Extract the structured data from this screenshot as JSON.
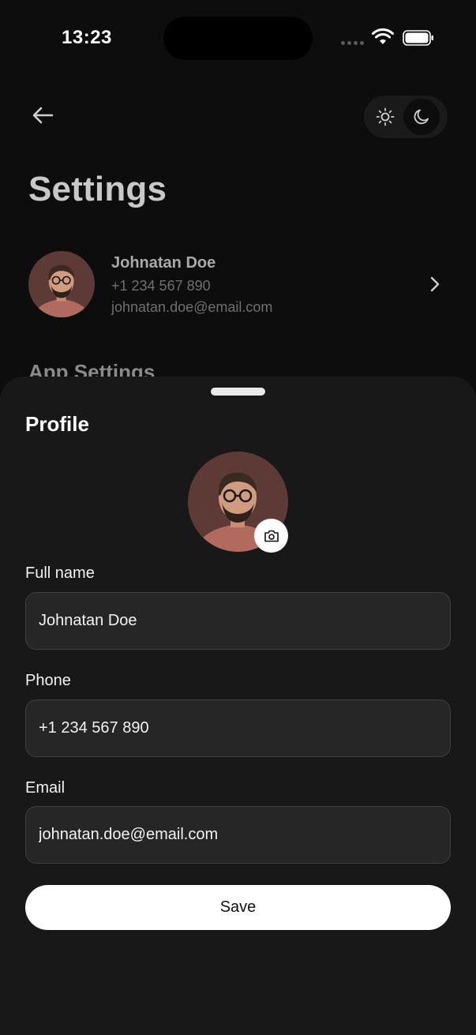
{
  "status_bar": {
    "time": "13:23"
  },
  "header": {
    "back_icon": "arrow-left-icon",
    "theme_options": [
      "sun-icon",
      "moon-icon"
    ],
    "theme_selected": "dark"
  },
  "page": {
    "title": "Settings"
  },
  "profile": {
    "name": "Johnatan Doe",
    "phone": "+1 234 567 890",
    "email": "johnatan.doe@email.com"
  },
  "section_peek": "App Settings",
  "sheet": {
    "title": "Profile",
    "fields": [
      {
        "label": "Full name",
        "value": "Johnatan Doe"
      },
      {
        "label": "Phone",
        "value": "+1 234 567 890"
      },
      {
        "label": "Email",
        "value": "johnatan.doe@email.com"
      }
    ],
    "save_label": "Save"
  },
  "colors": {
    "background": "#0d0d0d",
    "sheet": "#181818",
    "input": "#262626",
    "button": "#ffffff"
  }
}
